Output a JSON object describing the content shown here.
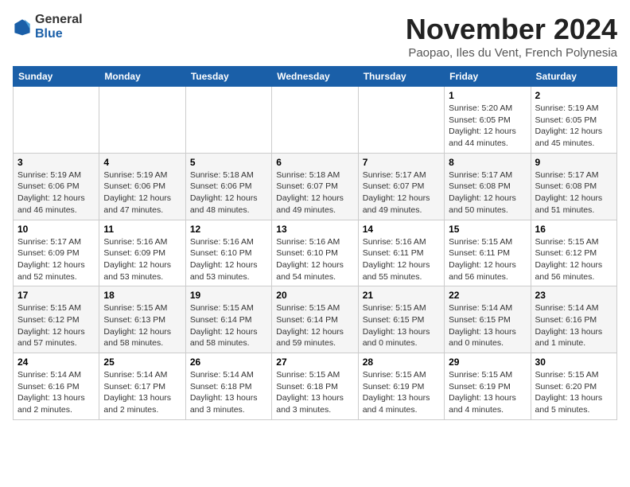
{
  "logo": {
    "general": "General",
    "blue": "Blue"
  },
  "title": "November 2024",
  "subtitle": "Paopao, Iles du Vent, French Polynesia",
  "weekdays": [
    "Sunday",
    "Monday",
    "Tuesday",
    "Wednesday",
    "Thursday",
    "Friday",
    "Saturday"
  ],
  "weeks": [
    [
      {
        "day": "",
        "info": ""
      },
      {
        "day": "",
        "info": ""
      },
      {
        "day": "",
        "info": ""
      },
      {
        "day": "",
        "info": ""
      },
      {
        "day": "",
        "info": ""
      },
      {
        "day": "1",
        "info": "Sunrise: 5:20 AM\nSunset: 6:05 PM\nDaylight: 12 hours\nand 44 minutes."
      },
      {
        "day": "2",
        "info": "Sunrise: 5:19 AM\nSunset: 6:05 PM\nDaylight: 12 hours\nand 45 minutes."
      }
    ],
    [
      {
        "day": "3",
        "info": "Sunrise: 5:19 AM\nSunset: 6:06 PM\nDaylight: 12 hours\nand 46 minutes."
      },
      {
        "day": "4",
        "info": "Sunrise: 5:19 AM\nSunset: 6:06 PM\nDaylight: 12 hours\nand 47 minutes."
      },
      {
        "day": "5",
        "info": "Sunrise: 5:18 AM\nSunset: 6:06 PM\nDaylight: 12 hours\nand 48 minutes."
      },
      {
        "day": "6",
        "info": "Sunrise: 5:18 AM\nSunset: 6:07 PM\nDaylight: 12 hours\nand 49 minutes."
      },
      {
        "day": "7",
        "info": "Sunrise: 5:17 AM\nSunset: 6:07 PM\nDaylight: 12 hours\nand 49 minutes."
      },
      {
        "day": "8",
        "info": "Sunrise: 5:17 AM\nSunset: 6:08 PM\nDaylight: 12 hours\nand 50 minutes."
      },
      {
        "day": "9",
        "info": "Sunrise: 5:17 AM\nSunset: 6:08 PM\nDaylight: 12 hours\nand 51 minutes."
      }
    ],
    [
      {
        "day": "10",
        "info": "Sunrise: 5:17 AM\nSunset: 6:09 PM\nDaylight: 12 hours\nand 52 minutes."
      },
      {
        "day": "11",
        "info": "Sunrise: 5:16 AM\nSunset: 6:09 PM\nDaylight: 12 hours\nand 53 minutes."
      },
      {
        "day": "12",
        "info": "Sunrise: 5:16 AM\nSunset: 6:10 PM\nDaylight: 12 hours\nand 53 minutes."
      },
      {
        "day": "13",
        "info": "Sunrise: 5:16 AM\nSunset: 6:10 PM\nDaylight: 12 hours\nand 54 minutes."
      },
      {
        "day": "14",
        "info": "Sunrise: 5:16 AM\nSunset: 6:11 PM\nDaylight: 12 hours\nand 55 minutes."
      },
      {
        "day": "15",
        "info": "Sunrise: 5:15 AM\nSunset: 6:11 PM\nDaylight: 12 hours\nand 56 minutes."
      },
      {
        "day": "16",
        "info": "Sunrise: 5:15 AM\nSunset: 6:12 PM\nDaylight: 12 hours\nand 56 minutes."
      }
    ],
    [
      {
        "day": "17",
        "info": "Sunrise: 5:15 AM\nSunset: 6:12 PM\nDaylight: 12 hours\nand 57 minutes."
      },
      {
        "day": "18",
        "info": "Sunrise: 5:15 AM\nSunset: 6:13 PM\nDaylight: 12 hours\nand 58 minutes."
      },
      {
        "day": "19",
        "info": "Sunrise: 5:15 AM\nSunset: 6:14 PM\nDaylight: 12 hours\nand 58 minutes."
      },
      {
        "day": "20",
        "info": "Sunrise: 5:15 AM\nSunset: 6:14 PM\nDaylight: 12 hours\nand 59 minutes."
      },
      {
        "day": "21",
        "info": "Sunrise: 5:15 AM\nSunset: 6:15 PM\nDaylight: 13 hours\nand 0 minutes."
      },
      {
        "day": "22",
        "info": "Sunrise: 5:14 AM\nSunset: 6:15 PM\nDaylight: 13 hours\nand 0 minutes."
      },
      {
        "day": "23",
        "info": "Sunrise: 5:14 AM\nSunset: 6:16 PM\nDaylight: 13 hours\nand 1 minute."
      }
    ],
    [
      {
        "day": "24",
        "info": "Sunrise: 5:14 AM\nSunset: 6:16 PM\nDaylight: 13 hours\nand 2 minutes."
      },
      {
        "day": "25",
        "info": "Sunrise: 5:14 AM\nSunset: 6:17 PM\nDaylight: 13 hours\nand 2 minutes."
      },
      {
        "day": "26",
        "info": "Sunrise: 5:14 AM\nSunset: 6:18 PM\nDaylight: 13 hours\nand 3 minutes."
      },
      {
        "day": "27",
        "info": "Sunrise: 5:15 AM\nSunset: 6:18 PM\nDaylight: 13 hours\nand 3 minutes."
      },
      {
        "day": "28",
        "info": "Sunrise: 5:15 AM\nSunset: 6:19 PM\nDaylight: 13 hours\nand 4 minutes."
      },
      {
        "day": "29",
        "info": "Sunrise: 5:15 AM\nSunset: 6:19 PM\nDaylight: 13 hours\nand 4 minutes."
      },
      {
        "day": "30",
        "info": "Sunrise: 5:15 AM\nSunset: 6:20 PM\nDaylight: 13 hours\nand 5 minutes."
      }
    ]
  ]
}
